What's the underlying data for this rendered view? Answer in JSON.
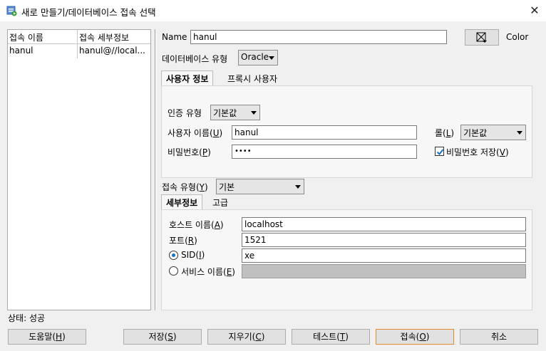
{
  "window": {
    "title": "새로 만들기/데이터베이스 접속 선택",
    "close_glyph": "✕"
  },
  "connections": {
    "headers": [
      "접속 이름",
      "접속 세부정보"
    ],
    "rows": [
      {
        "name": "hanul",
        "details": "hanul@//local..."
      }
    ]
  },
  "form": {
    "name_label": "Name",
    "name_value": "hanul",
    "color_label": "Color",
    "db_type_label": "데이터베이스 유형",
    "db_type_value": "Oracle",
    "tabs": [
      "사용자 정보",
      "프록시 사용자"
    ],
    "auth_type_label": "인증 유형",
    "auth_type_value": "기본값",
    "username_label": "사용자 이름(U)",
    "username_value": "hanul",
    "role_label": "롤(L)",
    "role_value": "기본값",
    "password_label": "비밀번호(P)",
    "password_value": "••••",
    "save_password_label": "비밀번호 저장(V)",
    "save_password_checked": true,
    "conn_type_label": "접속 유형(Y)",
    "conn_type_value": "기본",
    "detail_tabs": [
      "세부정보",
      "고급"
    ],
    "host_label": "호스트 이름(A)",
    "host_value": "localhost",
    "port_label": "포트(R)",
    "port_value": "1521",
    "sid_label": "SID(I)",
    "sid_value": "xe",
    "service_label": "서비스 이름(E)",
    "service_value": ""
  },
  "status": "상태: 성공",
  "buttons": {
    "help": "도움말(H)",
    "save": "저장(S)",
    "clear": "지우기(C)",
    "test": "테스트(T)",
    "connect": "접속(O)",
    "cancel": "취소"
  },
  "colors": {
    "accent": "#1a6fc9",
    "default_button_border": "#e08c2a"
  }
}
